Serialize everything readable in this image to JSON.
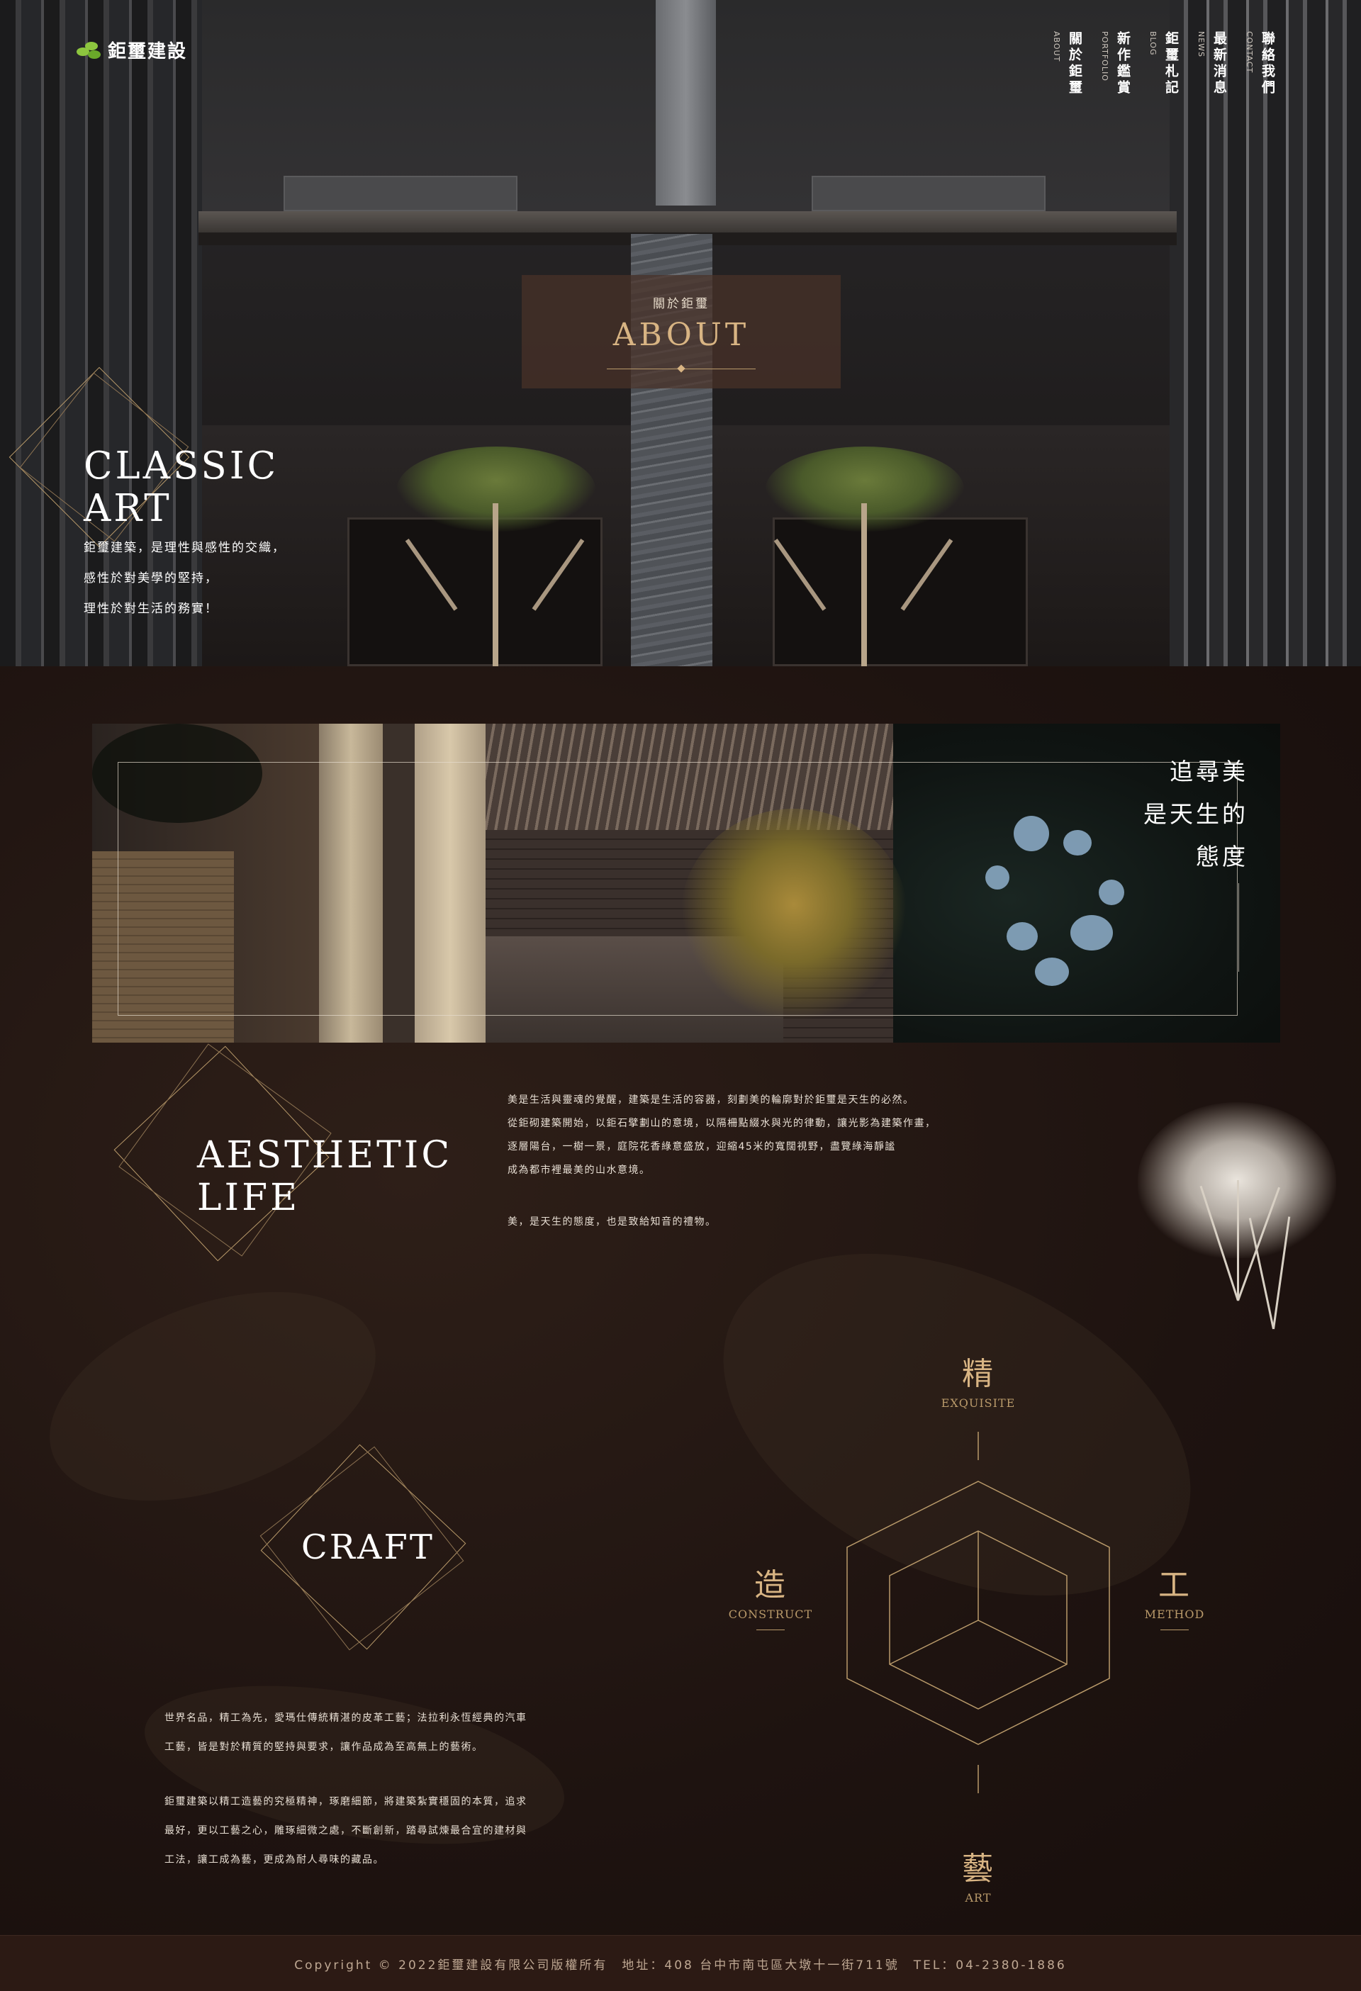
{
  "brand": {
    "name": "鉅璽建設",
    "logo_color": "#8dc63f"
  },
  "nav": {
    "items": [
      {
        "zh": "關於鉅璽",
        "en": "ABOUT"
      },
      {
        "zh": "新作鑑賞",
        "en": "PORTFOLIO"
      },
      {
        "zh": "鉅璽札記",
        "en": "BLOG"
      },
      {
        "zh": "最新消息",
        "en": "NEWS"
      },
      {
        "zh": "聯絡我們",
        "en": "CONTACT"
      }
    ]
  },
  "hero": {
    "section_zh": "關於鉅璽",
    "section_en": "ABOUT",
    "title_line1": "CLASSIC",
    "title_line2": "ART",
    "desc": [
      "鉅璽建築，是理性與感性的交織，",
      "感性於對美學的堅持，",
      "理性於對生活的務實！"
    ]
  },
  "banner": {
    "quote": [
      "追尋美",
      "是天生的",
      "態度"
    ]
  },
  "aesthetic": {
    "title_line1": "AESTHETIC",
    "title_line2": "LIFE",
    "paragraph": [
      "美是生活與靈魂的覺醒，建築是生活的容器，刻劃美的輪廓對於鉅璽是天生的必然。",
      "從鉅砌建築開始，以鉅石擘劃山的意境，以隔柵點綴水與光的律動，讓光影為建築作畫，",
      "逐層陽台，一樹一景，庭院花香綠意盛放，迎縮45米的寬闊視野，盡覽綠海靜謐",
      "成為都市裡最美的山水意境。"
    ],
    "closing": "美，是天生的態度，也是致給知音的禮物。"
  },
  "craft": {
    "title": "CRAFT",
    "paragraph1": [
      "世界名品，精工為先，愛瑪仕傳統精湛的皮革工藝；法拉利永恆經典的汽車",
      "工藝，皆是對於精質的堅持與要求，讓作品成為至高無上的藝術。"
    ],
    "paragraph2": [
      "鉅璽建築以精工造藝的究極精神，琢磨細節，將建築紮實穩固的本質，追求",
      "最好，更以工藝之心，雕琢細微之處，不斷創新，踏尋試煉最合宜的建材與",
      "工法，讓工成為藝，更成為耐人尋味的藏品。"
    ],
    "pillars": {
      "top": {
        "zh": "精",
        "en": "EXQUISITE"
      },
      "left": {
        "zh": "造",
        "en": "CONSTRUCT"
      },
      "right": {
        "zh": "工",
        "en": "METHOD"
      },
      "bottom": {
        "zh": "藝",
        "en": "ART"
      }
    },
    "accent": "#d8b483"
  },
  "footer": {
    "text": "Copyright © 2022鉅璽建設有限公司版權所有　地址：408 台中市南屯區大墩十一街711號　TEL：04-2380-1886"
  }
}
